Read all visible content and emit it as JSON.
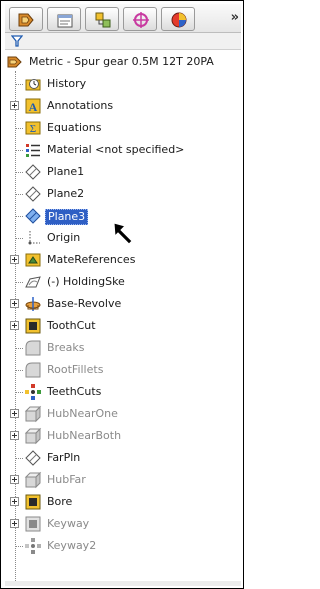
{
  "toolbar": {
    "buttons": [
      {
        "icon": "feature-manager-icon"
      },
      {
        "icon": "property-manager-icon"
      },
      {
        "icon": "configuration-manager-icon"
      },
      {
        "icon": "dimxpert-icon"
      },
      {
        "icon": "display-manager-icon"
      }
    ],
    "more_label": "»"
  },
  "filter": {
    "icon": "filter-icon"
  },
  "tree": {
    "root": {
      "label": "Metric - Spur gear 0.5M 12T 20PA",
      "icon": "part-icon"
    },
    "items": [
      {
        "label": "History",
        "icon": "history-icon",
        "expandable": false,
        "grey": false
      },
      {
        "label": "Annotations",
        "icon": "annotations-icon",
        "expandable": true,
        "grey": false
      },
      {
        "label": "Equations",
        "icon": "equations-icon",
        "expandable": false,
        "grey": false
      },
      {
        "label": "Material <not specified>",
        "icon": "material-icon",
        "expandable": false,
        "grey": false
      },
      {
        "label": "Plane1",
        "icon": "plane-icon",
        "expandable": false,
        "grey": false
      },
      {
        "label": "Plane2",
        "icon": "plane-icon",
        "expandable": false,
        "grey": false
      },
      {
        "label": "Plane3",
        "icon": "plane-icon",
        "expandable": false,
        "grey": false,
        "selected": true
      },
      {
        "label": "Origin",
        "icon": "origin-icon",
        "expandable": false,
        "grey": false
      },
      {
        "label": "MateReferences",
        "icon": "mate-references-icon",
        "expandable": true,
        "grey": false
      },
      {
        "label": "(-) HoldingSke",
        "icon": "sketch-icon",
        "expandable": false,
        "grey": false
      },
      {
        "label": "Base-Revolve",
        "icon": "revolve-icon",
        "expandable": true,
        "grey": false
      },
      {
        "label": "ToothCut",
        "icon": "cut-extrude-icon",
        "expandable": true,
        "grey": false
      },
      {
        "label": "Breaks",
        "icon": "fillet-icon",
        "expandable": false,
        "grey": true
      },
      {
        "label": "RootFillets",
        "icon": "fillet-icon",
        "expandable": false,
        "grey": true
      },
      {
        "label": "TeethCuts",
        "icon": "circular-pattern-icon",
        "expandable": false,
        "grey": false
      },
      {
        "label": "HubNearOne",
        "icon": "extrude-icon",
        "expandable": true,
        "grey": true
      },
      {
        "label": "HubNearBoth",
        "icon": "extrude-icon",
        "expandable": true,
        "grey": true
      },
      {
        "label": "FarPln",
        "icon": "plane-icon",
        "expandable": false,
        "grey": false
      },
      {
        "label": "HubFar",
        "icon": "extrude-icon",
        "expandable": true,
        "grey": true
      },
      {
        "label": "Bore",
        "icon": "cut-extrude-icon",
        "expandable": true,
        "grey": false
      },
      {
        "label": "Keyway",
        "icon": "cut-extrude-icon",
        "expandable": true,
        "grey": true
      },
      {
        "label": "Keyway2",
        "icon": "circular-pattern-icon",
        "expandable": false,
        "grey": true
      }
    ]
  },
  "colors": {
    "selection": "#2f5fc4",
    "suppressed_text": "#8a8a8a",
    "plane_selected": "#3a7ad8",
    "folder_yellow": "#f2c12e"
  }
}
